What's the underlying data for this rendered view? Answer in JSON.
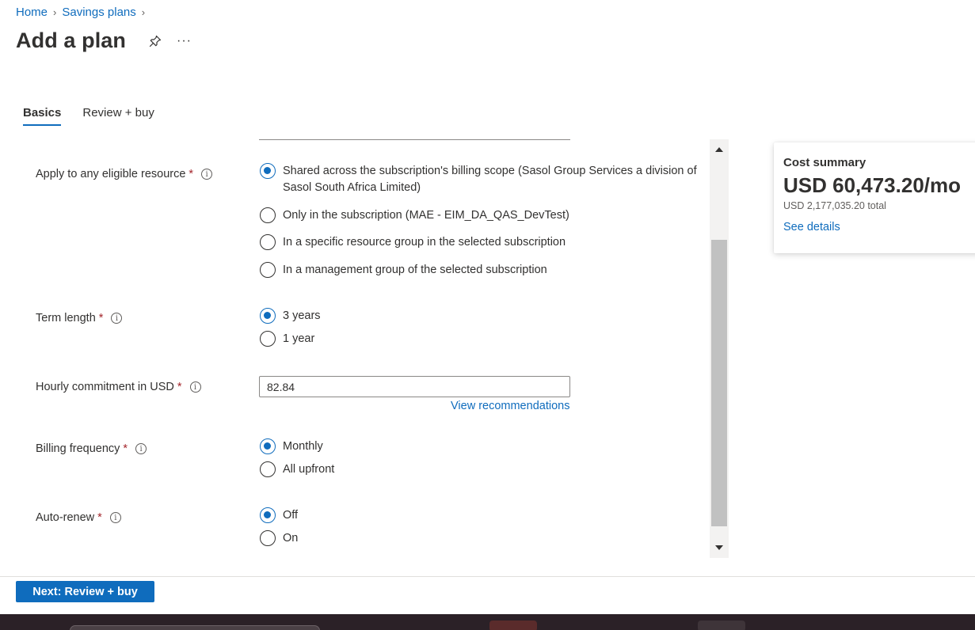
{
  "breadcrumb": {
    "home": "Home",
    "savings_plans": "Savings plans"
  },
  "page": {
    "title": "Add a plan",
    "more": "···"
  },
  "tabs": [
    {
      "label": "Basics"
    },
    {
      "label": "Review + buy"
    }
  ],
  "form": {
    "apply_to": {
      "label": "Apply to any eligible resource",
      "required": "*",
      "info": "i",
      "options": [
        "Shared across the subscription's billing scope (Sasol Group Services a division of Sasol South Africa Limited)",
        "Only in the subscription (MAE - EIM_DA_QAS_DevTest)",
        "In a specific resource group in the selected subscription",
        "In a management group of the selected subscription"
      ],
      "selected": 0
    },
    "term_length": {
      "label": "Term length",
      "required": "*",
      "info": "i",
      "options": [
        "3 years",
        "1 year"
      ],
      "selected": 0
    },
    "hourly_commitment": {
      "label": "Hourly commitment in USD",
      "required": "*",
      "info": "i",
      "value": "82.84",
      "link": "View recommendations"
    },
    "billing_frequency": {
      "label": "Billing frequency",
      "required": "*",
      "info": "i",
      "options": [
        "Monthly",
        "All upfront"
      ],
      "selected": 0
    },
    "auto_renew": {
      "label": "Auto-renew",
      "required": "*",
      "info": "i",
      "options": [
        "Off",
        "On"
      ],
      "selected": 0
    }
  },
  "cost_summary": {
    "title": "Cost summary",
    "amount": "USD 60,473.20/mo",
    "total": "USD 2,177,035.20 total",
    "link": "See details"
  },
  "footer": {
    "next_button": "Next: Review + buy"
  },
  "colors": {
    "accent": "#0f6cbd",
    "required": "#a4262c",
    "text": "#323130"
  }
}
